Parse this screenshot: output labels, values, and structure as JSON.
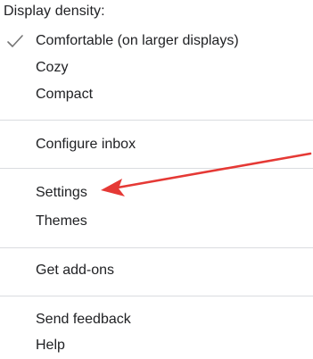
{
  "menu": {
    "header": "Display density:",
    "density_options": [
      {
        "label": "Comfortable (on larger displays)",
        "selected": true
      },
      {
        "label": "Cozy",
        "selected": false
      },
      {
        "label": "Compact",
        "selected": false
      }
    ],
    "configure_inbox": "Configure inbox",
    "settings": "Settings",
    "themes": "Themes",
    "get_addons": "Get add-ons",
    "send_feedback": "Send feedback",
    "help": "Help"
  },
  "colors": {
    "arrow": "#e53935",
    "text": "#202124",
    "divider": "#dadce0",
    "checkmark": "#757575"
  }
}
